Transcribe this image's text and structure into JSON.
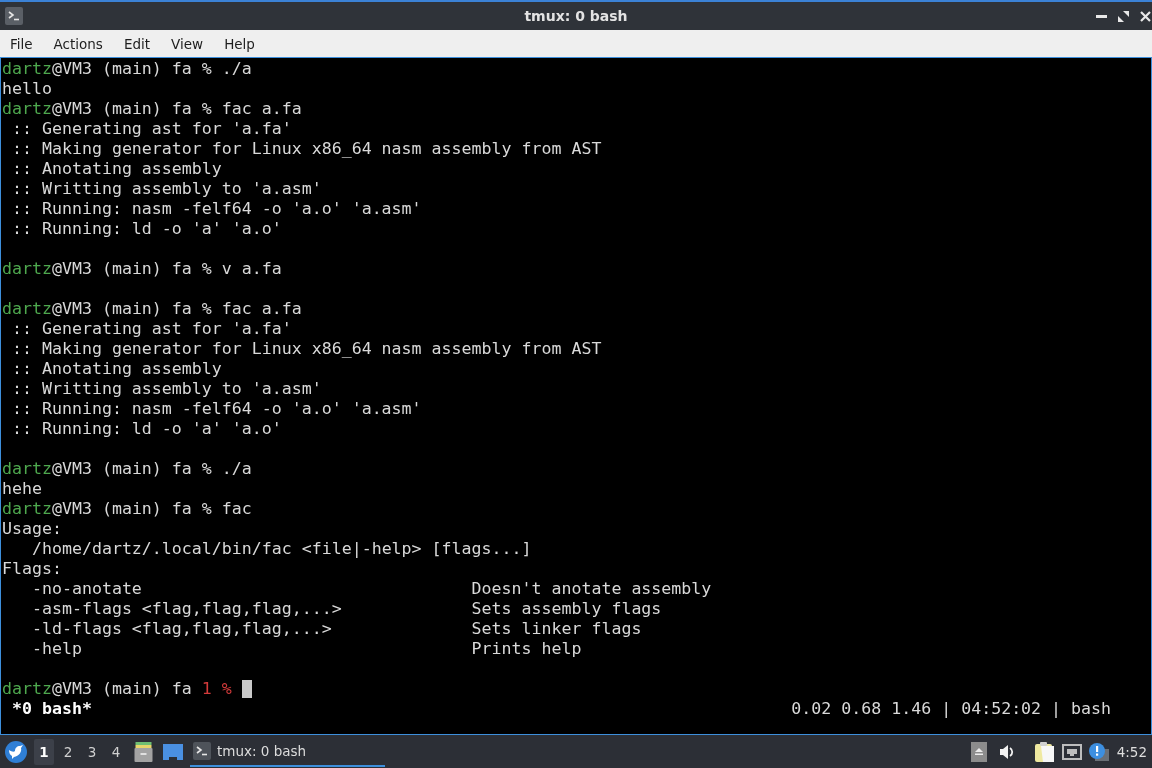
{
  "window": {
    "title": "tmux: 0 bash"
  },
  "menu_bar": [
    "File",
    "Actions",
    "Edit",
    "View",
    "Help"
  ],
  "terminal": {
    "lines": [
      {
        "kind": "prompt",
        "user": "dartz",
        "context": "@VM3 (main) fa",
        "symbol": "%",
        "error": false,
        "command": "./a",
        "cursor": false
      },
      {
        "kind": "output",
        "text": "hello"
      },
      {
        "kind": "prompt",
        "user": "dartz",
        "context": "@VM3 (main) fa",
        "symbol": "%",
        "error": false,
        "command": "fac a.fa",
        "cursor": false
      },
      {
        "kind": "log",
        "text": ":: Generating ast for 'a.fa'"
      },
      {
        "kind": "log",
        "text": ":: Making generator for Linux x86_64 nasm assembly from AST"
      },
      {
        "kind": "log",
        "text": ":: Anotating assembly"
      },
      {
        "kind": "log",
        "text": ":: Writting assembly to 'a.asm'"
      },
      {
        "kind": "log",
        "text": ":: Running: nasm -felf64 -o 'a.o' 'a.asm'"
      },
      {
        "kind": "log",
        "text": ":: Running: ld -o 'a' 'a.o'"
      },
      {
        "kind": "blank"
      },
      {
        "kind": "prompt",
        "user": "dartz",
        "context": "@VM3 (main) fa",
        "symbol": "%",
        "error": false,
        "command": "v a.fa",
        "cursor": false
      },
      {
        "kind": "blank"
      },
      {
        "kind": "prompt",
        "user": "dartz",
        "context": "@VM3 (main) fa",
        "symbol": "%",
        "error": false,
        "command": "fac a.fa",
        "cursor": false
      },
      {
        "kind": "log",
        "text": ":: Generating ast for 'a.fa'"
      },
      {
        "kind": "log",
        "text": ":: Making generator for Linux x86_64 nasm assembly from AST"
      },
      {
        "kind": "log",
        "text": ":: Anotating assembly"
      },
      {
        "kind": "log",
        "text": ":: Writting assembly to 'a.asm'"
      },
      {
        "kind": "log",
        "text": ":: Running: nasm -felf64 -o 'a.o' 'a.asm'"
      },
      {
        "kind": "log",
        "text": ":: Running: ld -o 'a' 'a.o'"
      },
      {
        "kind": "blank"
      },
      {
        "kind": "prompt",
        "user": "dartz",
        "context": "@VM3 (main) fa",
        "symbol": "%",
        "error": false,
        "command": "./a",
        "cursor": false
      },
      {
        "kind": "output",
        "text": "hehe"
      },
      {
        "kind": "prompt",
        "user": "dartz",
        "context": "@VM3 (main) fa",
        "symbol": "%",
        "error": false,
        "command": "fac",
        "cursor": false
      },
      {
        "kind": "output",
        "text": "Usage:"
      },
      {
        "kind": "indented",
        "text": "/home/dartz/.local/bin/fac <file|-help> [flags...]"
      },
      {
        "kind": "output",
        "text": "Flags:"
      },
      {
        "kind": "flag",
        "flag": "-no-anotate",
        "description": "Doesn't anotate assembly"
      },
      {
        "kind": "flag",
        "flag": "-asm-flags <flag,flag,flag,...>",
        "description": "Sets assembly flags"
      },
      {
        "kind": "flag",
        "flag": "-ld-flags <flag,flag,flag,...>",
        "description": "Sets linker flags"
      },
      {
        "kind": "flag",
        "flag": "-help",
        "description": "Prints help"
      },
      {
        "kind": "blank"
      },
      {
        "kind": "prompt",
        "user": "dartz",
        "context": "@VM3 (main) fa",
        "symbol": "1 %",
        "error": true,
        "cursor": true
      }
    ],
    "status_bar": {
      "windows": [
        {
          "label": "*0 bash*",
          "selected": true
        }
      ],
      "info": "0.02 0.68 1.46 | 04:52:02 | bash"
    }
  },
  "taskbar": {
    "workspaces": [
      {
        "label": "1",
        "selected": true
      },
      {
        "label": "2",
        "selected": false
      },
      {
        "label": "3",
        "selected": false
      },
      {
        "label": "4",
        "selected": false
      }
    ],
    "tasks": [
      {
        "title": "tmux: 0 bash",
        "selected": true
      }
    ],
    "clock": "4:52"
  }
}
